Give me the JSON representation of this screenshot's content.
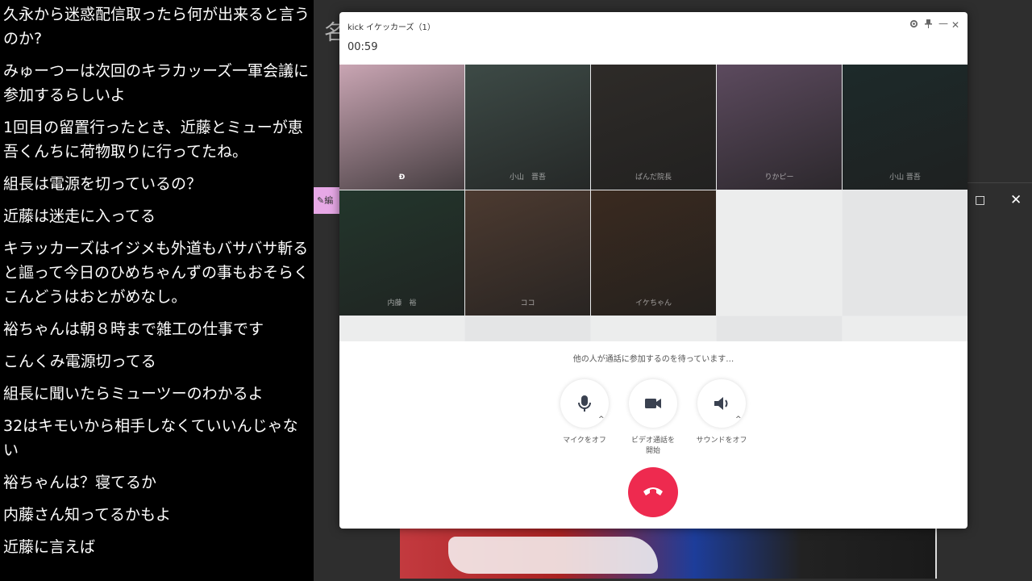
{
  "comments": [
    "久永から迷惑配信取ったら何が出来ると言うのか?",
    "みゅーつーは次回のキラカッーズ一軍会議に参加するらしいよ",
    "1回目の留置行ったとき、近藤とミューが恵吾くんちに荷物取りに行ってたね。",
    "組長は電源を切っているの？",
    "近藤は迷走に入ってる",
    "キラッカーズはイジメも外道もバサバサ斬ると謳って今日のひめちゃんずの事もおそらくこんどうはおとがめなし。",
    "裕ちゃんは朝８時まで雑工の仕事です",
    "こんくみ電源切ってる",
    "組長に聞いたらミューツーのわかるよ",
    "32はキモいから相手しなくていいんじゃない",
    "裕ちゃんは？寝てるか",
    "内藤さん知ってるかもよ",
    "近藤に言えば"
  ],
  "background": {
    "title_char": "名",
    "edit_tab": "編",
    "maximize": "□",
    "close": "✕"
  },
  "call": {
    "title": "kick イケッカーズ（1）",
    "timer": "00:59",
    "controls": {
      "settings": "⚙",
      "pin": "📌",
      "minimize": "—",
      "close": "✕"
    },
    "participants": [
      {
        "name": "Ð",
        "active": true,
        "color": "#c9a5b3"
      },
      {
        "name": "小山　晋吾",
        "active": false,
        "color": "#3d4a46"
      },
      {
        "name": "ぱんだ院長",
        "active": false,
        "color": "#2e2b28"
      },
      {
        "name": "りかピー",
        "active": false,
        "color": "#5c4a5e"
      },
      {
        "name": "小山 晋吾",
        "active": false,
        "color": "#1d2a2a"
      },
      {
        "name": "内藤　裕",
        "active": false,
        "color": "#23362c"
      },
      {
        "name": "ココ",
        "active": false,
        "color": "#4c3a30"
      },
      {
        "name": "イケちゃん",
        "active": false,
        "color": "#3a2a1f"
      }
    ],
    "waiting_text": "他の人が通話に参加するのを待っています…",
    "buttons": {
      "mic_label": "マイクをオフ",
      "video_label_1": "ビデオ通話を",
      "video_label_2": "開始",
      "sound_label": "サウンドをオフ"
    },
    "hangup_color": "#ee2a4f"
  }
}
